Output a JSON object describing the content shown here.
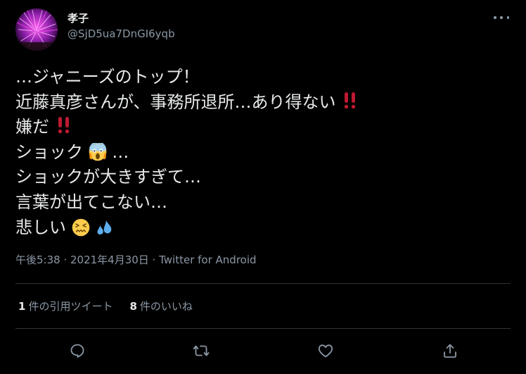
{
  "user": {
    "display_name": "孝子",
    "handle": "@SjD5ua7DnGI6yqb"
  },
  "tweet": {
    "lines": [
      {
        "text": "…ジャニーズのトップ！"
      },
      {
        "text": "近藤真彦さんが、事務所退所…あり得ない"
      },
      {
        "text": "嫌だ"
      },
      {
        "text": "ショック"
      },
      {
        "text": "ショックが大きすぎて…"
      },
      {
        "text": "言葉が出てこない…"
      },
      {
        "text": "悲しい"
      }
    ],
    "line4_suffix": "…",
    "emojis": {
      "double_exclamation": "‼️",
      "screaming_face": "😱",
      "confounded_face": "😖",
      "sweat_droplets": "💦"
    },
    "meta": "午後5:38 · 2021年4月30日 · Twitter for Android"
  },
  "stats": {
    "quotes_count": "1",
    "quotes_label": "件の引用ツイート",
    "likes_count": "8",
    "likes_label": "件のいいね"
  },
  "actions": {
    "reply": "reply-icon",
    "retweet": "retweet-icon",
    "like": "heart-icon",
    "share": "share-icon"
  },
  "colors": {
    "background": "#000000",
    "text": "#e7e9ea",
    "secondary": "#8b98a5",
    "divider": "#2f3336",
    "bangs": "#be1931"
  }
}
